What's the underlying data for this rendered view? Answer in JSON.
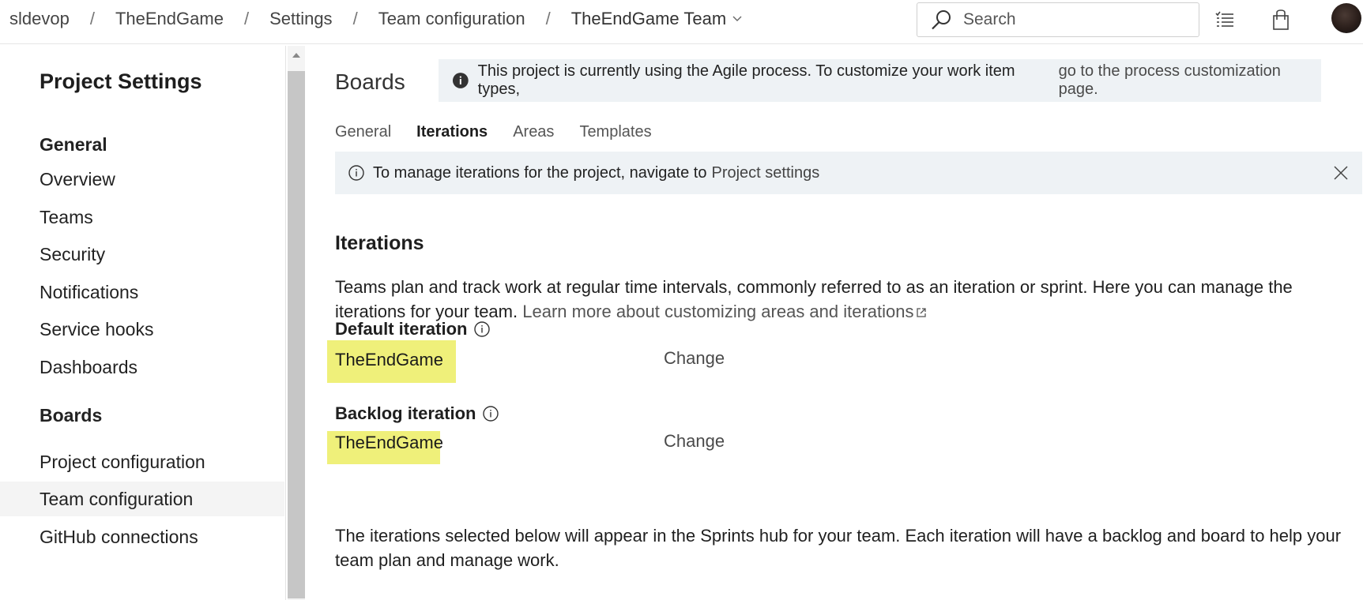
{
  "breadcrumb": {
    "items": [
      "sldevop",
      "TheEndGame",
      "Settings",
      "Team configuration"
    ],
    "team": "TheEndGame Team",
    "separator": "/"
  },
  "search": {
    "placeholder": "Search"
  },
  "top_icons": [
    "list-icon",
    "shopping-bag-icon"
  ],
  "sidebar": {
    "title": "Project Settings",
    "sections": [
      {
        "label": "General",
        "items": [
          "Overview",
          "Teams",
          "Security",
          "Notifications",
          "Service hooks",
          "Dashboards"
        ]
      },
      {
        "label": "Boards",
        "items": [
          "Project configuration",
          "Team configuration",
          "GitHub connections"
        ]
      }
    ],
    "selected": "Team configuration"
  },
  "main": {
    "title": "Boards",
    "process_banner": {
      "text": "This project is currently using the Agile process. To customize your work item types,",
      "link": "go to the process customization page."
    },
    "tabs": [
      "General",
      "Iterations",
      "Areas",
      "Templates"
    ],
    "active_tab": "Iterations",
    "manage_banner": {
      "text": "To manage iterations for the project, navigate to",
      "link": "Project settings"
    },
    "iterations": {
      "heading": "Iterations",
      "description": "Teams plan and track work at regular time intervals, commonly referred to as an iteration or sprint. Here you can manage the iterations for your team.",
      "learn_more": "Learn more about customizing areas and iterations",
      "default_label": "Default iteration",
      "default_value": "TheEndGame",
      "backlog_label": "Backlog iteration",
      "backlog_value": "TheEndGame",
      "change_label": "Change",
      "bottom_text": "The iterations selected below will appear in the Sprints hub for your team. Each iteration will have a backlog and board to help your team plan and manage work."
    }
  },
  "colors": {
    "highlight": "#eff07a",
    "banner_bg": "#eef2f5",
    "selected_item_bg": "#f4f4f4"
  }
}
